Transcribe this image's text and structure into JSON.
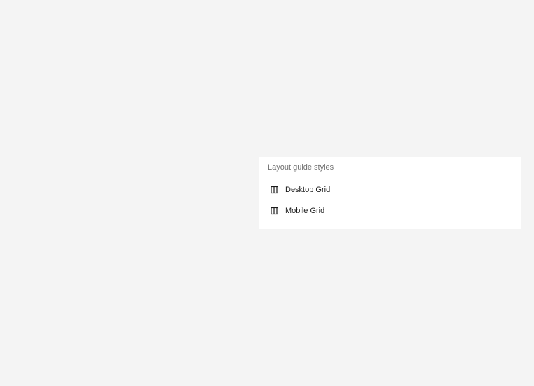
{
  "panel": {
    "title": "Layout guide styles",
    "items": [
      {
        "label": "Desktop Grid",
        "icon": "layout-grid-columns-icon"
      },
      {
        "label": "Mobile Grid",
        "icon": "layout-grid-columns-icon"
      }
    ]
  },
  "colors": {
    "background": "#f4f4f4",
    "panel": "#ffffff",
    "title_text": "#707070",
    "item_text": "#1a1a1a"
  }
}
